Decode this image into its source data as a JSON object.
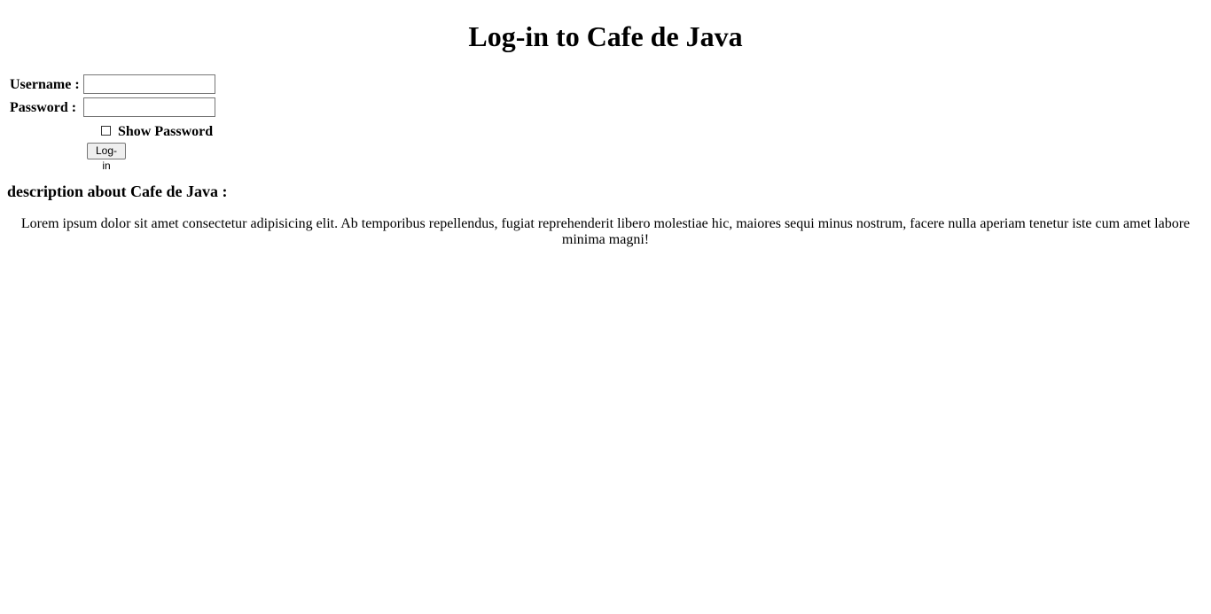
{
  "page": {
    "title": "Log-in to Cafe de Java"
  },
  "login_form": {
    "username_label": "Username :",
    "username_value": "",
    "password_label": "Password :",
    "password_value": "",
    "show_password_label": "Show Password",
    "show_password_checked": false,
    "login_button_label": "Log-in"
  },
  "description": {
    "heading": "description about Cafe de Java :",
    "text": "Lorem ipsum dolor sit amet consectetur adipisicing elit. Ab temporibus repellendus, fugiat reprehenderit libero molestiae hic, maiores sequi minus nostrum, facere nulla aperiam tenetur iste cum amet labore minima magni!"
  }
}
